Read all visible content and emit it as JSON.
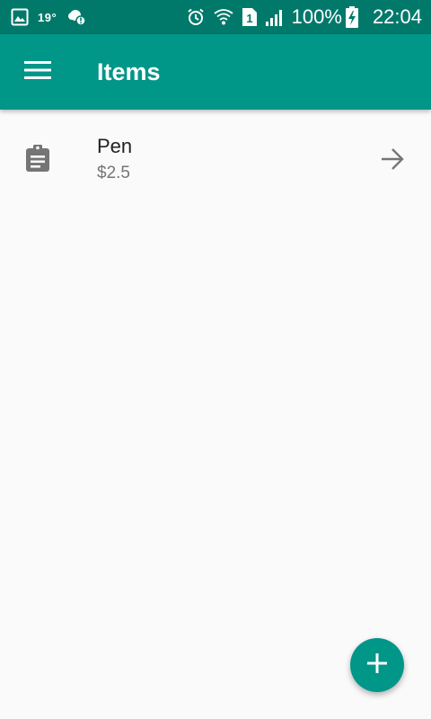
{
  "status_bar": {
    "temperature": "19°",
    "battery_percent": "100%",
    "time": "22:04",
    "sim_slot": "1",
    "icons": [
      "image-icon",
      "weather-icon",
      "alarm-icon",
      "wifi-icon",
      "sim-icon",
      "signal-icon",
      "battery-charging-icon"
    ]
  },
  "app_bar": {
    "title": "Items",
    "menu_icon": "menu-icon",
    "color": "#009688"
  },
  "items": [
    {
      "name": "Pen",
      "price": "$2.5",
      "leading_icon": "clipboard-icon",
      "trailing_icon": "arrow-forward-icon"
    }
  ],
  "fab": {
    "icon": "add-icon",
    "color": "#009688"
  },
  "colors": {
    "status_bar": "#00796b",
    "primary": "#009688",
    "background": "#fafafa"
  }
}
